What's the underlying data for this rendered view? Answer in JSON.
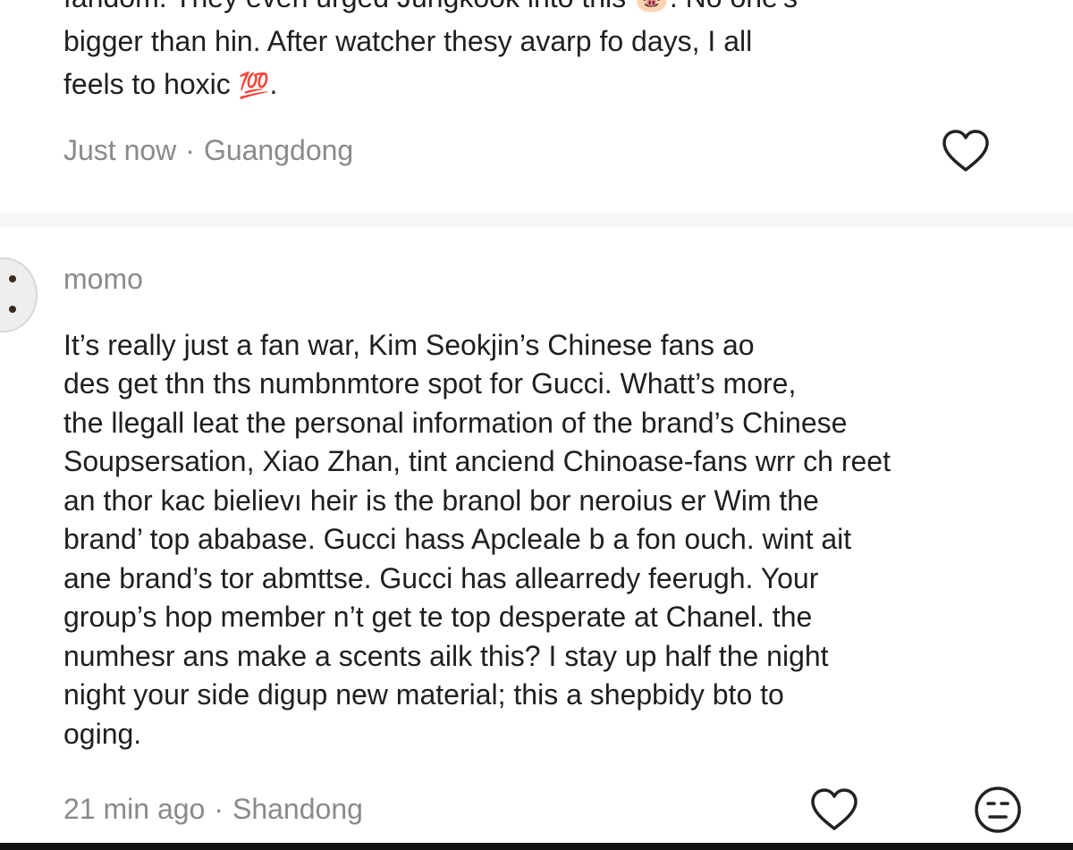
{
  "comment1": {
    "lines": [
      "fandom. They even urged Jungkook into this 🐷. No one's",
      "bigger than hin. After watcher thesy avarp fo days, I all",
      "feels to hoxic"
    ],
    "emoji_2": "💯",
    "trailing": ".",
    "time": "Just now",
    "separator": "·",
    "location": "Guangdong"
  },
  "comment2": {
    "username": "momo",
    "lines": [
      "It’s really just a fan war, Kim Seokjin’s Chinese fans ao",
      "des get thn ths numbnmtore spot for Gucci. Whatt’s more,",
      "the llegall leat the personal information of the brand’s Chinese",
      "Soupsersation, Xiao Zhan, tint anciend Chinoase-fans wrr ch reet",
      "an thor kac bielievı heir is the branol bor neroius er Wim the",
      "brand’ top ababase. Gucci hass Apcleale b a fon ouch. wint ait",
      "ane brand’s tor abmttse. Gucci has allearredy feerugh. Your",
      "group’s hop member n’t get te top desperate at Chanel. the",
      "numhesr ans make a scents ailk this?  I stay up half the night",
      "night your side digup new material; this a shepbidy bto to",
      "oging."
    ],
    "time": "21 min ago",
    "separator": "·",
    "location": "Shandong"
  },
  "icons": {
    "like": "heart-outline-icon",
    "reaction": "neutral-face-icon"
  },
  "colors": {
    "text": "#1f1f1f",
    "meta": "#8a8a8a",
    "icon": "#222222"
  }
}
